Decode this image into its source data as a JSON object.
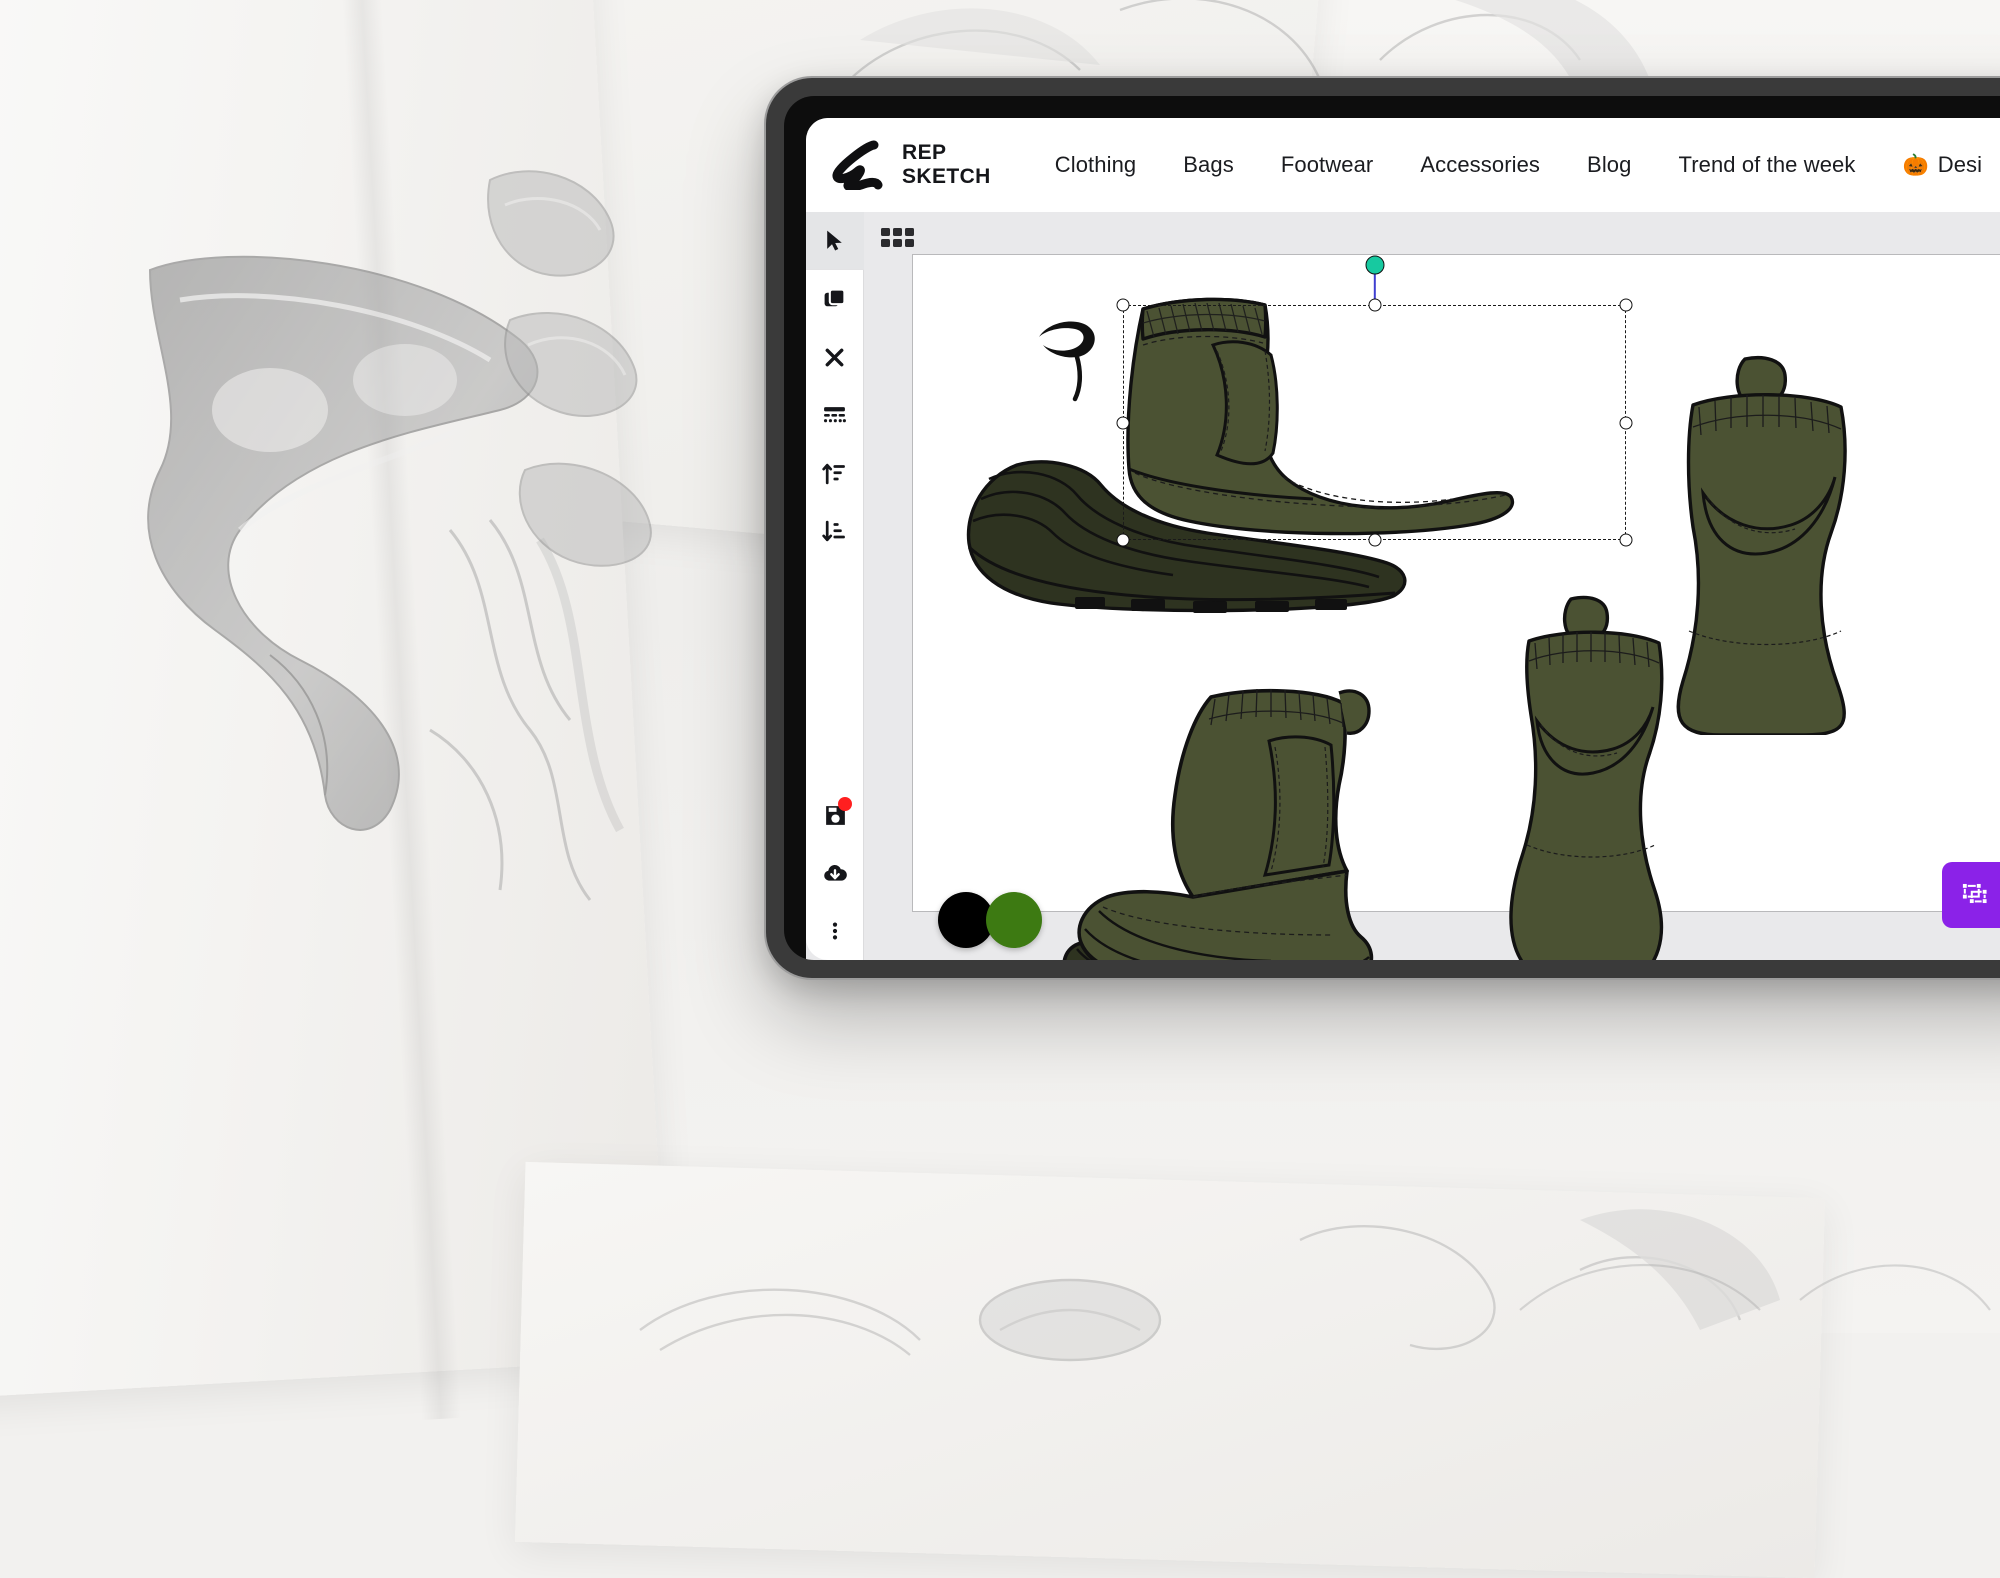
{
  "background": {
    "description": "photograph of white sketch paper sheets with grey pencil shoe sketches"
  },
  "device": {
    "type": "tablet"
  },
  "header": {
    "logo_icon": "rep-sketch-scribble-logo",
    "brand_name": "REP\nSKETCH",
    "nav": [
      {
        "label": "Clothing"
      },
      {
        "label": "Bags"
      },
      {
        "label": "Footwear"
      },
      {
        "label": "Accessories"
      },
      {
        "label": "Blog"
      },
      {
        "label": "Trend of the week"
      },
      {
        "label": "Desi",
        "emoji": "🎃"
      }
    ]
  },
  "toolbar": {
    "tools": [
      {
        "name": "select-tool",
        "icon": "cursor-arrow-icon",
        "active": true
      },
      {
        "name": "duplicate-tool",
        "icon": "copy-layers-icon",
        "active": false
      },
      {
        "name": "delete-tool",
        "icon": "close-x-icon",
        "active": false
      },
      {
        "name": "line-style-tool",
        "icon": "line-weights-icon",
        "active": false
      },
      {
        "name": "sort-ascending-tool",
        "icon": "sort-ascending-icon",
        "active": false
      },
      {
        "name": "sort-descending-tool",
        "icon": "sort-descending-icon",
        "active": false
      }
    ],
    "bottom_tools": [
      {
        "name": "save-tool",
        "icon": "floppy-save-icon",
        "has_notification": true
      },
      {
        "name": "download-tool",
        "icon": "cloud-download-icon",
        "has_notification": false
      },
      {
        "name": "more-options-tool",
        "icon": "more-vertical-icon",
        "has_notification": false
      }
    ]
  },
  "canvas": {
    "grid_icon": "grid-apps-icon",
    "artwork_title": "olive green chelsea boot technical flats",
    "selection": {
      "active": true,
      "rotation_handle_color": "#17c9a0",
      "handle_count": 8
    }
  },
  "palette": {
    "swatches": [
      {
        "name": "swatch-black",
        "color": "#000000"
      },
      {
        "name": "swatch-olive-green",
        "color": "#3d7a12"
      }
    ]
  },
  "actions": {
    "accent_color": "#8b22e8",
    "buttons": [
      {
        "name": "transform-nodes-button",
        "icon": "vector-nodes-icon"
      },
      {
        "name": "edit-button",
        "icon": "edit-square-pencil-icon"
      }
    ]
  },
  "colors": {
    "boot_upper": "#4b5233",
    "boot_sole": "#2e3320",
    "outline": "#111111",
    "canvas_bg": "#e9e9eb",
    "app_bg": "#ffffff",
    "device_bezel": "#3a3a3a"
  }
}
